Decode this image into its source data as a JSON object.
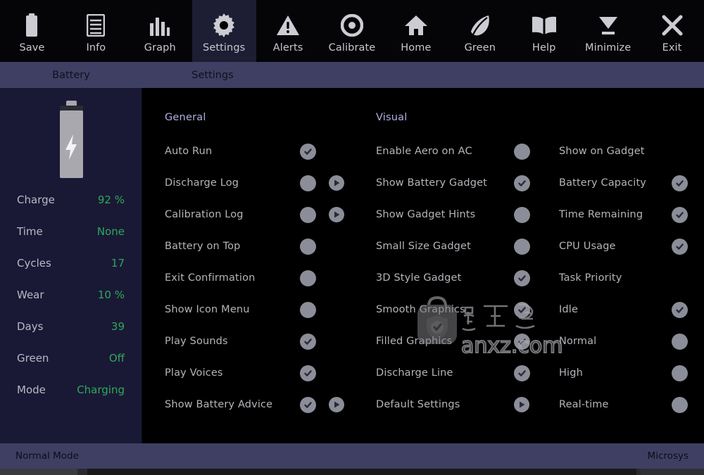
{
  "toolbar": {
    "items": [
      {
        "label": "Save",
        "icon": "battery-icon",
        "active": false
      },
      {
        "label": "Info",
        "icon": "list-icon",
        "active": false
      },
      {
        "label": "Graph",
        "icon": "bars-icon",
        "active": false
      },
      {
        "label": "Settings",
        "icon": "gear-icon",
        "active": true
      },
      {
        "label": "Alerts",
        "icon": "warning-icon",
        "active": false
      },
      {
        "label": "Calibrate",
        "icon": "target-icon",
        "active": false
      },
      {
        "label": "Home",
        "icon": "home-icon",
        "active": false
      },
      {
        "label": "Green",
        "icon": "leaf-icon",
        "active": false
      },
      {
        "label": "Help",
        "icon": "book-icon",
        "active": false
      },
      {
        "label": "Minimize",
        "icon": "minimize-icon",
        "active": false
      },
      {
        "label": "Exit",
        "icon": "close-icon",
        "active": false
      }
    ]
  },
  "tabs": [
    {
      "label": "Battery"
    },
    {
      "label": "Settings"
    }
  ],
  "sidebar": {
    "battery_icon": "battery-charging-icon",
    "stats": [
      {
        "key": "Charge",
        "value": "92 %"
      },
      {
        "key": "Time",
        "value": "None"
      },
      {
        "key": "Cycles",
        "value": "17"
      },
      {
        "key": "Wear",
        "value": "10 %"
      },
      {
        "key": "Days",
        "value": "39"
      },
      {
        "key": "Green",
        "value": "Off"
      },
      {
        "key": "Mode",
        "value": "Charging"
      }
    ]
  },
  "settings": {
    "general": {
      "heading": "General",
      "options": [
        {
          "label": "Auto Run",
          "checked": true,
          "play": false
        },
        {
          "label": "Discharge Log",
          "checked": false,
          "play": true
        },
        {
          "label": "Calibration Log",
          "checked": false,
          "play": true
        },
        {
          "label": "Battery on Top",
          "checked": false,
          "play": false
        },
        {
          "label": "Exit Confirmation",
          "checked": false,
          "play": false
        },
        {
          "label": "Show Icon Menu",
          "checked": false,
          "play": false
        },
        {
          "label": "Play Sounds",
          "checked": true,
          "play": false
        },
        {
          "label": "Play Voices",
          "checked": true,
          "play": false
        },
        {
          "label": "Show Battery Advice",
          "checked": true,
          "play": true
        }
      ]
    },
    "visual": {
      "heading": "Visual",
      "options": [
        {
          "label": "Enable Aero on AC",
          "checked": false,
          "play": false
        },
        {
          "label": "Show Battery Gadget",
          "checked": true,
          "play": false
        },
        {
          "label": "Show Gadget Hints",
          "checked": false,
          "play": false
        },
        {
          "label": "Small Size Gadget",
          "checked": false,
          "play": false
        },
        {
          "label": "3D Style Gadget",
          "checked": true,
          "play": false
        },
        {
          "label": "Smooth Graphics",
          "checked": true,
          "play": false
        },
        {
          "label": "Filled Graphics",
          "checked": true,
          "play": false
        },
        {
          "label": "Discharge Line",
          "checked": true,
          "play": false
        },
        {
          "label": "Default Settings",
          "checked": null,
          "play": true
        }
      ]
    },
    "gadget": {
      "heading": "Show on Gadget",
      "priority_heading": "Task Priority",
      "options": [
        {
          "label": "Battery Capacity",
          "checked": true,
          "play": false
        },
        {
          "label": "Time Remaining",
          "checked": true,
          "play": false
        },
        {
          "label": "CPU Usage",
          "checked": true,
          "play": false
        },
        {
          "label": "Idle",
          "checked": true,
          "play": false
        },
        {
          "label": "Normal",
          "checked": false,
          "play": false
        },
        {
          "label": "High",
          "checked": false,
          "play": false
        },
        {
          "label": "Real-time",
          "checked": false,
          "play": false
        }
      ]
    }
  },
  "statusbar": {
    "mode": "Normal Mode",
    "brand": "Microsys"
  },
  "watermark": {
    "text": "anxz.com",
    "cjk": "安下载"
  },
  "colors": {
    "toolbar_bg": "#050508",
    "tabbar_bg": "#3e3f63",
    "sidebar_bg": "#191936",
    "main_bg": "#000000",
    "accent_heading": "#aeaee0",
    "stat_value": "#2fa85a",
    "toggle": "#8b8d98"
  }
}
